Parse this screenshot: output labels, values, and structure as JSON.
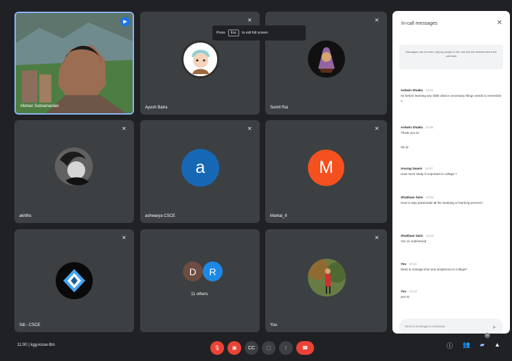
{
  "pin_tooltip": {
    "prefix": "Press",
    "key": "Esc",
    "suffix": "to exit full screen"
  },
  "tiles": [
    {
      "name": "Mohan Subramanian"
    },
    {
      "name": "Ayush Batra"
    },
    {
      "name": "Sumit Rai"
    },
    {
      "name": "akriths"
    },
    {
      "name": "ashwarya CSCE",
      "initial": "a"
    },
    {
      "name": "Markai_II",
      "initial": "M"
    },
    {
      "name": "Sdi - CSCE"
    },
    {
      "name": "11 others",
      "initials": [
        "D",
        "R"
      ]
    },
    {
      "name": "You"
    }
  ],
  "panel": {
    "title": "In-call messages",
    "notice": "Messages can be seen only by people in the call and are deleted when the call ends",
    "messages": [
      {
        "sender": "Ashwin Shukla",
        "time": "10:02",
        "text": "Sir before learning any skills what is necessary things needs to remember ?"
      },
      {
        "sender": "Ashwin Shukla",
        "time": "10:05",
        "text": "Thank you sir"
      },
      {
        "sender": "",
        "time": "",
        "text": "Ok sir"
      },
      {
        "sender": "Anurag Swami",
        "time": "10:07",
        "text": "How much study is important in college ?"
      },
      {
        "sender": "Shubham Saini",
        "time": "10:08",
        "text": "How to stay passionate all the studying or learning process?"
      },
      {
        "sender": "Shubham Saini",
        "time": "10:10",
        "text": "Yes sir understood"
      },
      {
        "sender": "You",
        "time": "10:11",
        "text": "Want to manage time and academics in college?"
      },
      {
        "sender": "You",
        "time": "10:13",
        "text": "yes sir"
      }
    ],
    "composer_placeholder": "Send a message to everyone"
  },
  "bottom": {
    "meeting_code": "11:00 | kgg-kssw-tbn",
    "people_count": "20"
  }
}
